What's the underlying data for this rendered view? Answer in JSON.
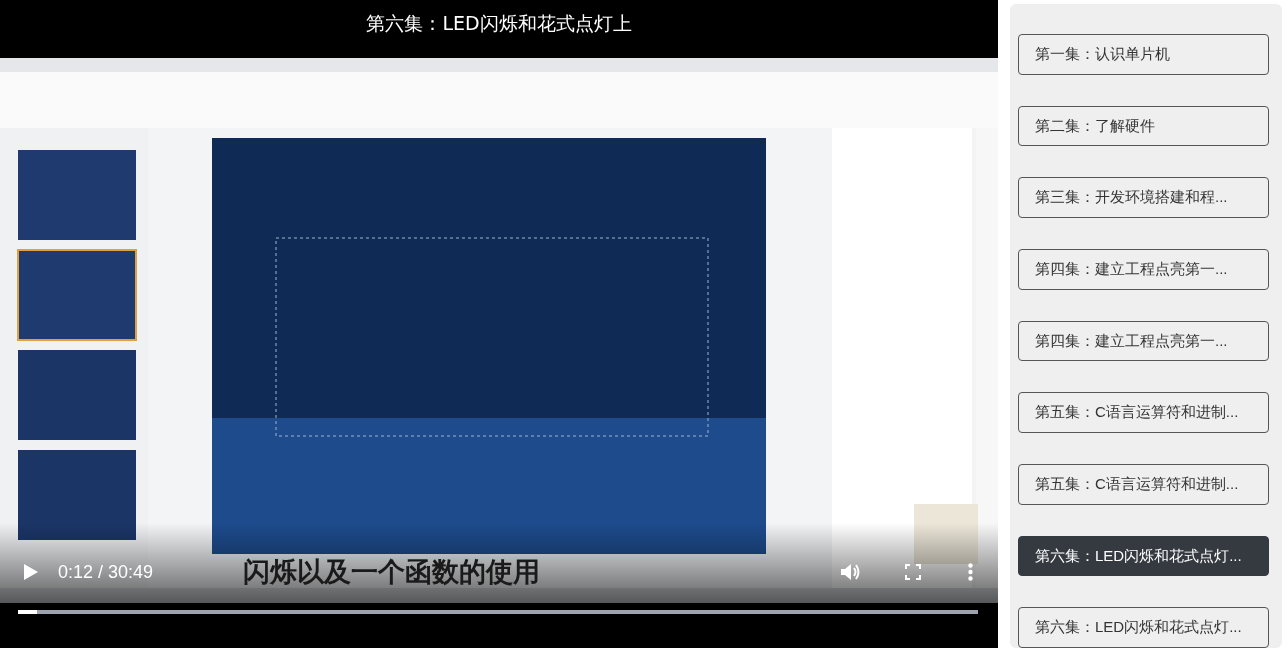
{
  "player": {
    "title": "第六集：LED闪烁和花式点灯上",
    "subtitle": "闪烁以及一个函数的使用",
    "time": "0:12 / 30:49",
    "progress": {
      "level": 0.02
    }
  },
  "playlist": [
    {
      "label": "第一集：认识单片机",
      "selected": false
    },
    {
      "label": "第二集：了解硬件",
      "selected": false
    },
    {
      "label": "第三集：开发环境搭建和程...",
      "selected": false
    },
    {
      "label": "第四集：建立工程点亮第一...",
      "selected": false
    },
    {
      "label": "第四集：建立工程点亮第一...",
      "selected": false
    },
    {
      "label": "第五集：C语言运算符和进制...",
      "selected": false
    },
    {
      "label": "第五集：C语言运算符和进制...",
      "selected": false
    },
    {
      "label": "第六集：LED闪烁和花式点灯...",
      "selected": true
    },
    {
      "label": "第六集：LED闪烁和花式点灯...",
      "selected": false
    }
  ]
}
